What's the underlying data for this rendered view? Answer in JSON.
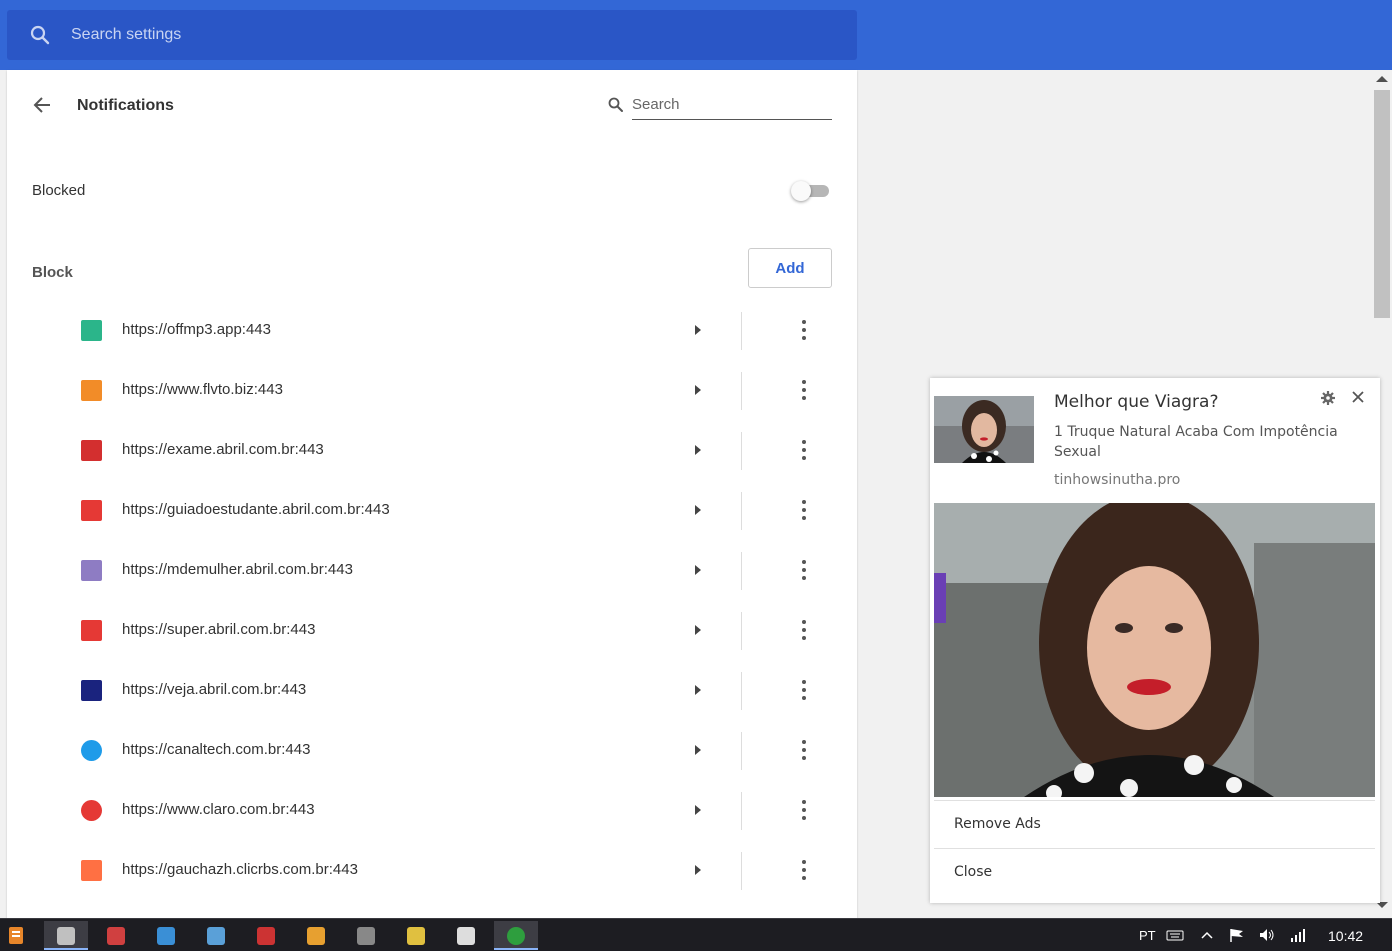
{
  "settings": {
    "search_placeholder": "Search settings",
    "page_title": "Notifications",
    "sub_search_placeholder": "Search",
    "blocked_label": "Blocked",
    "blocked_toggle_on": false,
    "block_section_label": "Block",
    "add_label": "Add",
    "sites": [
      {
        "url": "https://offmp3.app:443",
        "icon": "offmp3-favicon",
        "color": "#2bb58a"
      },
      {
        "url": "https://www.flvto.biz:443",
        "icon": "flvto-favicon",
        "color": "#f28c28"
      },
      {
        "url": "https://exame.abril.com.br:443",
        "icon": "exame-favicon",
        "color": "#d32f2f"
      },
      {
        "url": "https://guiadoestudante.abril.com.br:443",
        "icon": "guiadoestudante-favicon",
        "color": "#e53935"
      },
      {
        "url": "https://mdemulher.abril.com.br:443",
        "icon": "mdemulher-favicon",
        "color": "#8e7cc3"
      },
      {
        "url": "https://super.abril.com.br:443",
        "icon": "super-favicon",
        "color": "#e53935"
      },
      {
        "url": "https://veja.abril.com.br:443",
        "icon": "veja-favicon",
        "color": "#1a237e"
      },
      {
        "url": "https://canaltech.com.br:443",
        "icon": "canaltech-favicon",
        "color": "#1e9be9"
      },
      {
        "url": "https://www.claro.com.br:443",
        "icon": "claro-favicon",
        "color": "#e53935"
      },
      {
        "url": "https://gauchazh.clicrbs.com.br:443",
        "icon": "gauchazh-favicon",
        "color": "#ff7043"
      }
    ]
  },
  "notification": {
    "title": "Melhor que Viagra? ",
    "body": "1 Truque Natural Acaba Com Impotência Sexual",
    "domain": "tinhowsinutha.pro",
    "remove_ads_label": " Remove Ads",
    "close_label": "Close"
  },
  "taskbar": {
    "language": "PT",
    "time": "10:42",
    "apps": [
      "app-icon-1",
      "app-icon-2",
      "app-icon-3",
      "app-icon-4",
      "app-icon-5",
      "app-icon-6",
      "app-icon-7",
      "app-icon-8",
      "app-icon-9",
      "utorrent-icon"
    ]
  },
  "colors": {
    "accent": "#3367d6",
    "search_bg": "#2a56c6",
    "add_text": "#3367d6"
  }
}
